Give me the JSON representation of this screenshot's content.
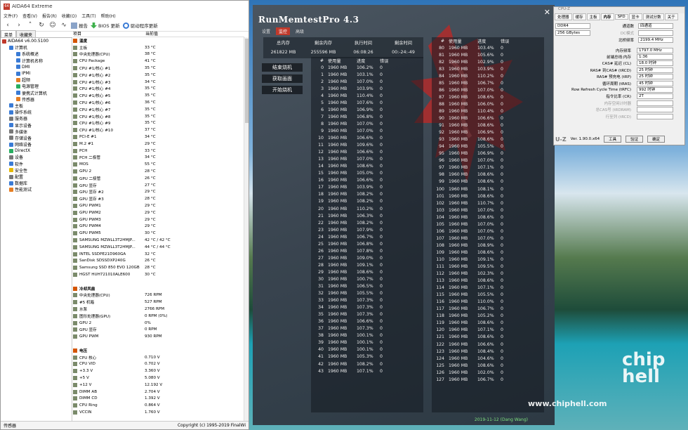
{
  "aida": {
    "title": "AIDA64 Extreme",
    "menu": [
      "文件(F)",
      "查看(V)",
      "报告(R)",
      "收藏(O)",
      "工具(T)",
      "帮助(H)"
    ],
    "toolbar": {
      "report": "报告",
      "bios": "BIOS 更新",
      "driver": "驱动程序更新"
    },
    "tabs": [
      "菜单",
      "收藏夹"
    ],
    "pane_headers": [
      "项目",
      "当前值"
    ],
    "tree": [
      {
        "label": "AIDA64 v6.00.5100",
        "indent": 0,
        "color": "#c0392b"
      },
      {
        "label": "计算机",
        "indent": 1,
        "color": "#3a7bd5"
      },
      {
        "label": "系统概述",
        "indent": 2,
        "color": "#3a7bd5"
      },
      {
        "label": "计算机名称",
        "indent": 2,
        "color": "#3a7bd5"
      },
      {
        "label": "DMI",
        "indent": 2,
        "color": "#3a7bd5"
      },
      {
        "label": "IPMI",
        "indent": 2,
        "color": "#3a7bd5"
      },
      {
        "label": "超频",
        "indent": 2,
        "color": "#e67e22"
      },
      {
        "label": "电源管理",
        "indent": 2,
        "color": "#27ae60"
      },
      {
        "label": "便携式计算机",
        "indent": 2,
        "color": "#3a7bd5"
      },
      {
        "label": "传感器",
        "indent": 2,
        "color": "#e67e22"
      },
      {
        "label": "主板",
        "indent": 1,
        "color": "#3a7bd5"
      },
      {
        "label": "操作系统",
        "indent": 1,
        "color": "#3a7bd5"
      },
      {
        "label": "服务器",
        "indent": 1,
        "color": "#777777"
      },
      {
        "label": "显示设备",
        "indent": 1,
        "color": "#3a7bd5"
      },
      {
        "label": "多媒体",
        "indent": 1,
        "color": "#777777"
      },
      {
        "label": "存储设备",
        "indent": 1,
        "color": "#777777"
      },
      {
        "label": "网络设备",
        "indent": 1,
        "color": "#3a7bd5"
      },
      {
        "label": "DirectX",
        "indent": 1,
        "color": "#27ae60"
      },
      {
        "label": "设备",
        "indent": 1,
        "color": "#777777"
      },
      {
        "label": "软件",
        "indent": 1,
        "color": "#3a7bd5"
      },
      {
        "label": "安全性",
        "indent": 1,
        "color": "#e6b800"
      },
      {
        "label": "配置",
        "indent": 1,
        "color": "#777777"
      },
      {
        "label": "数据库",
        "indent": 1,
        "color": "#3a7bd5"
      },
      {
        "label": "性能测试",
        "indent": 1,
        "color": "#e67e22"
      }
    ],
    "sensors": [
      {
        "name": "温度",
        "value": "",
        "head": true
      },
      {
        "name": "主板",
        "value": "33 °C"
      },
      {
        "name": "中央处理器(CPU)",
        "value": "38 °C"
      },
      {
        "name": "CPU Package",
        "value": "41 °C"
      },
      {
        "name": "CPU #1/核心 #1",
        "value": "35 °C"
      },
      {
        "name": "CPU #1/核心 #2",
        "value": "35 °C"
      },
      {
        "name": "CPU #1/核心 #3",
        "value": "34 °C"
      },
      {
        "name": "CPU #1/核心 #4",
        "value": "35 °C"
      },
      {
        "name": "CPU #1/核心 #5",
        "value": "35 °C"
      },
      {
        "name": "CPU #1/核心 #6",
        "value": "36 °C"
      },
      {
        "name": "CPU #1/核心 #7",
        "value": "35 °C"
      },
      {
        "name": "CPU #1/核心 #8",
        "value": "35 °C"
      },
      {
        "name": "CPU #1/核心 #9",
        "value": "35 °C"
      },
      {
        "name": "CPU #1/核心 #10",
        "value": "37 °C"
      },
      {
        "name": "PCI-E #1",
        "value": "34 °C"
      },
      {
        "name": "M.2 #1",
        "value": "29 °C"
      },
      {
        "name": "PCH",
        "value": "33 °C"
      },
      {
        "name": "PCH 二极管",
        "value": "34 °C"
      },
      {
        "name": "MOS",
        "value": "55 °C"
      },
      {
        "name": "GPU 2",
        "value": "28 °C"
      },
      {
        "name": "GPU 二极管",
        "value": "26 °C"
      },
      {
        "name": "GPU 显存",
        "value": "27 °C"
      },
      {
        "name": "GPU 显存 #2",
        "value": "29 °C"
      },
      {
        "name": "GPU 显存 #3",
        "value": "28 °C"
      },
      {
        "name": "GPU PWM1",
        "value": "29 °C"
      },
      {
        "name": "GPU PWM2",
        "value": "29 °C"
      },
      {
        "name": "GPU PWM3",
        "value": "29 °C"
      },
      {
        "name": "GPU PWM4",
        "value": "29 °C"
      },
      {
        "name": "GPU PWM5",
        "value": "30 °C"
      },
      {
        "name": "SAMSUNG MZWLL3T2HMJP...",
        "value": "42 °C / 42 °C"
      },
      {
        "name": "SAMSUNG MZWLL3T2HMJP...",
        "value": "44 °C / 44 °C"
      },
      {
        "name": "INTEL SSDPE21D960GA",
        "value": "32 °C"
      },
      {
        "name": "SanDisk SDSSDXP240G",
        "value": "26 °C"
      },
      {
        "name": "Samsung SSD 850 EVO 120GB",
        "value": "28 °C"
      },
      {
        "name": "HGST HUH721010ALE600",
        "value": "30 °C"
      },
      {
        "name": "",
        "value": "",
        "blank": true
      },
      {
        "name": "冷却风扇",
        "value": "",
        "head": true
      },
      {
        "name": "中央处理器(CPU)",
        "value": "726 RPM"
      },
      {
        "name": "#5 机箱",
        "value": "527 RPM"
      },
      {
        "name": "水泵",
        "value": "2766 RPM"
      },
      {
        "name": "图形处理器(GPU)",
        "value": "0 RPM  (0%)"
      },
      {
        "name": "GPU 2",
        "value": "0%"
      },
      {
        "name": "GPU 显存",
        "value": "0 RPM"
      },
      {
        "name": "GPU PWM",
        "value": "930 RPM"
      },
      {
        "name": "",
        "value": "",
        "blank": true
      },
      {
        "name": "电压",
        "value": "",
        "head": true
      },
      {
        "name": "CPU 核心",
        "value": "0.710 V"
      },
      {
        "name": "CPU VID",
        "value": "0.702 V"
      },
      {
        "name": "+3.3 V",
        "value": "3.360 V"
      },
      {
        "name": "+5 V",
        "value": "5.080 V"
      },
      {
        "name": "+12 V",
        "value": "12.192 V"
      },
      {
        "name": "DIMM AB",
        "value": "2.704 V"
      },
      {
        "name": "DIMM CD",
        "value": "1.392 V"
      },
      {
        "name": "CPU Ring",
        "value": "0.864 V"
      },
      {
        "name": "VCCIN",
        "value": "1.760 V"
      }
    ],
    "status_left": "传感器",
    "status_right": "Copyright (c) 1995-2019 FinalWi"
  },
  "rmt": {
    "title": "RunMemtestPro 4.3",
    "tabs": [
      "设置",
      "监控",
      "高级"
    ],
    "active_tab": 1,
    "summary_headers": [
      "总内存",
      "剩余内存",
      "执行时间",
      "剩余时间"
    ],
    "summary_values": [
      "261822 MB",
      "255596 MB",
      "06:08:26",
      "00:-24:-49"
    ],
    "buttons": [
      "结束烧机",
      "获取画面",
      "开始烧机"
    ],
    "col_headers": [
      "#",
      "使用量",
      "进度",
      "错误"
    ],
    "left_rows": [
      [
        "0",
        "1960 MB",
        "106.2%",
        "0"
      ],
      [
        "1",
        "1960 MB",
        "103.1%",
        "0"
      ],
      [
        "2",
        "1960 MB",
        "107.0%",
        "0"
      ],
      [
        "3",
        "1960 MB",
        "103.9%",
        "0"
      ],
      [
        "4",
        "1960 MB",
        "110.4%",
        "0"
      ],
      [
        "5",
        "1960 MB",
        "107.6%",
        "0"
      ],
      [
        "6",
        "1960 MB",
        "106.9%",
        "0"
      ],
      [
        "7",
        "1960 MB",
        "106.8%",
        "0"
      ],
      [
        "8",
        "1960 MB",
        "107.0%",
        "0"
      ],
      [
        "9",
        "1960 MB",
        "107.0%",
        "0"
      ],
      [
        "10",
        "1960 MB",
        "106.6%",
        "0"
      ],
      [
        "11",
        "1960 MB",
        "109.6%",
        "0"
      ],
      [
        "12",
        "1960 MB",
        "106.6%",
        "0"
      ],
      [
        "13",
        "1960 MB",
        "107.0%",
        "0"
      ],
      [
        "14",
        "1960 MB",
        "108.6%",
        "0"
      ],
      [
        "15",
        "1960 MB",
        "105.0%",
        "0"
      ],
      [
        "16",
        "1960 MB",
        "106.6%",
        "0"
      ],
      [
        "17",
        "1960 MB",
        "103.9%",
        "0"
      ],
      [
        "18",
        "1960 MB",
        "108.2%",
        "0"
      ],
      [
        "19",
        "1960 MB",
        "108.2%",
        "0"
      ],
      [
        "20",
        "1960 MB",
        "110.2%",
        "0"
      ],
      [
        "21",
        "1960 MB",
        "106.3%",
        "0"
      ],
      [
        "22",
        "1960 MB",
        "108.2%",
        "0"
      ],
      [
        "23",
        "1960 MB",
        "107.9%",
        "0"
      ],
      [
        "24",
        "1960 MB",
        "106.7%",
        "0"
      ],
      [
        "25",
        "1960 MB",
        "106.8%",
        "0"
      ],
      [
        "26",
        "1960 MB",
        "107.8%",
        "0"
      ],
      [
        "27",
        "1960 MB",
        "109.0%",
        "0"
      ],
      [
        "28",
        "1960 MB",
        "109.1%",
        "0"
      ],
      [
        "29",
        "1960 MB",
        "108.6%",
        "0"
      ],
      [
        "30",
        "1960 MB",
        "100.7%",
        "0"
      ],
      [
        "31",
        "1960 MB",
        "106.5%",
        "0"
      ],
      [
        "32",
        "1960 MB",
        "105.5%",
        "0"
      ],
      [
        "33",
        "1960 MB",
        "107.3%",
        "0"
      ],
      [
        "34",
        "1960 MB",
        "107.3%",
        "0"
      ],
      [
        "35",
        "1960 MB",
        "107.3%",
        "0"
      ],
      [
        "36",
        "1960 MB",
        "106.6%",
        "0"
      ],
      [
        "37",
        "1960 MB",
        "107.3%",
        "0"
      ],
      [
        "38",
        "1960 MB",
        "100.1%",
        "0"
      ],
      [
        "39",
        "1960 MB",
        "100.1%",
        "0"
      ],
      [
        "40",
        "1960 MB",
        "100.1%",
        "0"
      ],
      [
        "41",
        "1960 MB",
        "105.3%",
        "0"
      ],
      [
        "42",
        "1960 MB",
        "108.2%",
        "0"
      ],
      [
        "43",
        "1960 MB",
        "107.1%",
        "0"
      ]
    ],
    "right_rows": [
      [
        "80",
        "1960 MB",
        "103.4%",
        "0"
      ],
      [
        "81",
        "1960 MB",
        "105.6%",
        "0"
      ],
      [
        "82",
        "1960 MB",
        "102.9%",
        "0"
      ],
      [
        "83",
        "1960 MB",
        "103.9%",
        "0"
      ],
      [
        "84",
        "1960 MB",
        "110.2%",
        "0"
      ],
      [
        "85",
        "1960 MB",
        "106.7%",
        "0"
      ],
      [
        "86",
        "1960 MB",
        "107.0%",
        "0"
      ],
      [
        "87",
        "1960 MB",
        "108.6%",
        "0"
      ],
      [
        "88",
        "1960 MB",
        "106.0%",
        "0"
      ],
      [
        "89",
        "1960 MB",
        "110.4%",
        "0"
      ],
      [
        "90",
        "1960 MB",
        "106.6%",
        "0"
      ],
      [
        "91",
        "1960 MB",
        "108.6%",
        "0"
      ],
      [
        "92",
        "1960 MB",
        "106.9%",
        "0"
      ],
      [
        "93",
        "1960 MB",
        "108.6%",
        "0"
      ],
      [
        "94",
        "1960 MB",
        "105.5%",
        "0"
      ],
      [
        "95",
        "1960 MB",
        "106.9%",
        "0"
      ],
      [
        "96",
        "1960 MB",
        "107.0%",
        "0"
      ],
      [
        "97",
        "1960 MB",
        "107.1%",
        "0"
      ],
      [
        "98",
        "1960 MB",
        "108.6%",
        "0"
      ],
      [
        "99",
        "1960 MB",
        "108.6%",
        "0"
      ],
      [
        "100",
        "1960 MB",
        "108.1%",
        "0"
      ],
      [
        "101",
        "1960 MB",
        "108.6%",
        "0"
      ],
      [
        "102",
        "1960 MB",
        "110.7%",
        "0"
      ],
      [
        "103",
        "1960 MB",
        "107.0%",
        "0"
      ],
      [
        "104",
        "1960 MB",
        "108.6%",
        "0"
      ],
      [
        "105",
        "1960 MB",
        "107.0%",
        "0"
      ],
      [
        "106",
        "1960 MB",
        "107.0%",
        "0"
      ],
      [
        "107",
        "1960 MB",
        "107.0%",
        "0"
      ],
      [
        "108",
        "1960 MB",
        "108.9%",
        "0"
      ],
      [
        "109",
        "1960 MB",
        "108.6%",
        "0"
      ],
      [
        "110",
        "1960 MB",
        "109.1%",
        "0"
      ],
      [
        "111",
        "1960 MB",
        "109.5%",
        "0"
      ],
      [
        "112",
        "1960 MB",
        "102.3%",
        "0"
      ],
      [
        "113",
        "1960 MB",
        "108.6%",
        "0"
      ],
      [
        "114",
        "1960 MB",
        "107.1%",
        "0"
      ],
      [
        "115",
        "1960 MB",
        "105.5%",
        "0"
      ],
      [
        "116",
        "1960 MB",
        "110.0%",
        "0"
      ],
      [
        "117",
        "1960 MB",
        "106.7%",
        "0"
      ],
      [
        "118",
        "1960 MB",
        "105.2%",
        "0"
      ],
      [
        "119",
        "1960 MB",
        "108.6%",
        "0"
      ],
      [
        "120",
        "1960 MB",
        "107.1%",
        "0"
      ],
      [
        "121",
        "1960 MB",
        "108.6%",
        "0"
      ],
      [
        "122",
        "1960 MB",
        "106.6%",
        "0"
      ],
      [
        "123",
        "1960 MB",
        "108.4%",
        "0"
      ],
      [
        "124",
        "1960 MB",
        "104.6%",
        "0"
      ],
      [
        "125",
        "1960 MB",
        "108.6%",
        "0"
      ],
      [
        "126",
        "1960 MB",
        "102.0%",
        "0"
      ],
      [
        "127",
        "1960 MB",
        "106.7%",
        "0"
      ]
    ],
    "footer": "2019-11-12 (Dang Wang)"
  },
  "cpuz": {
    "title": "CPU-Z",
    "tabs": [
      "处理器",
      "缓存",
      "主板",
      "内存",
      "SPD",
      "显卡",
      "测试分数",
      "关于"
    ],
    "active_tab": 3,
    "type_value": "DDR4",
    "size_value": "256 GBytes",
    "channel_label": "通道数",
    "channel_value": "四通道",
    "dc_label": "DC模式",
    "nb_label": "北桥频率",
    "nb_value": "2199.4 MHz",
    "timings": [
      {
        "label": "内存频率",
        "value": "1797.0 MHz"
      },
      {
        "label": "前端总线:内存",
        "value": "1:36"
      },
      {
        "label": "CAS# 延迟 (CL)",
        "value": "18.0 时钟"
      },
      {
        "label": "RAS# 到CAS# (tRCD)",
        "value": "25 时钟"
      },
      {
        "label": "RAS# 预充电 (tRP)",
        "value": "25 时钟"
      },
      {
        "label": "循环周期 (tRAS)",
        "value": "45 时钟"
      },
      {
        "label": "Row Refresh Cycle Time (tRFC)",
        "value": "992 时钟"
      },
      {
        "label": "指令比率 (CR)",
        "value": "2T"
      },
      {
        "label": "内存空闲计时器",
        "value": ""
      },
      {
        "label": "总CAS号 (tRDRAM)",
        "value": ""
      },
      {
        "label": "行至列 (tRCD)",
        "value": ""
      }
    ],
    "version": "Ver. 1.90.0.x64",
    "tools": "工具",
    "validate": "验证",
    "ok": "确定"
  },
  "watermark": {
    "url": "www.chiphell.com",
    "logo": "chip hell"
  }
}
